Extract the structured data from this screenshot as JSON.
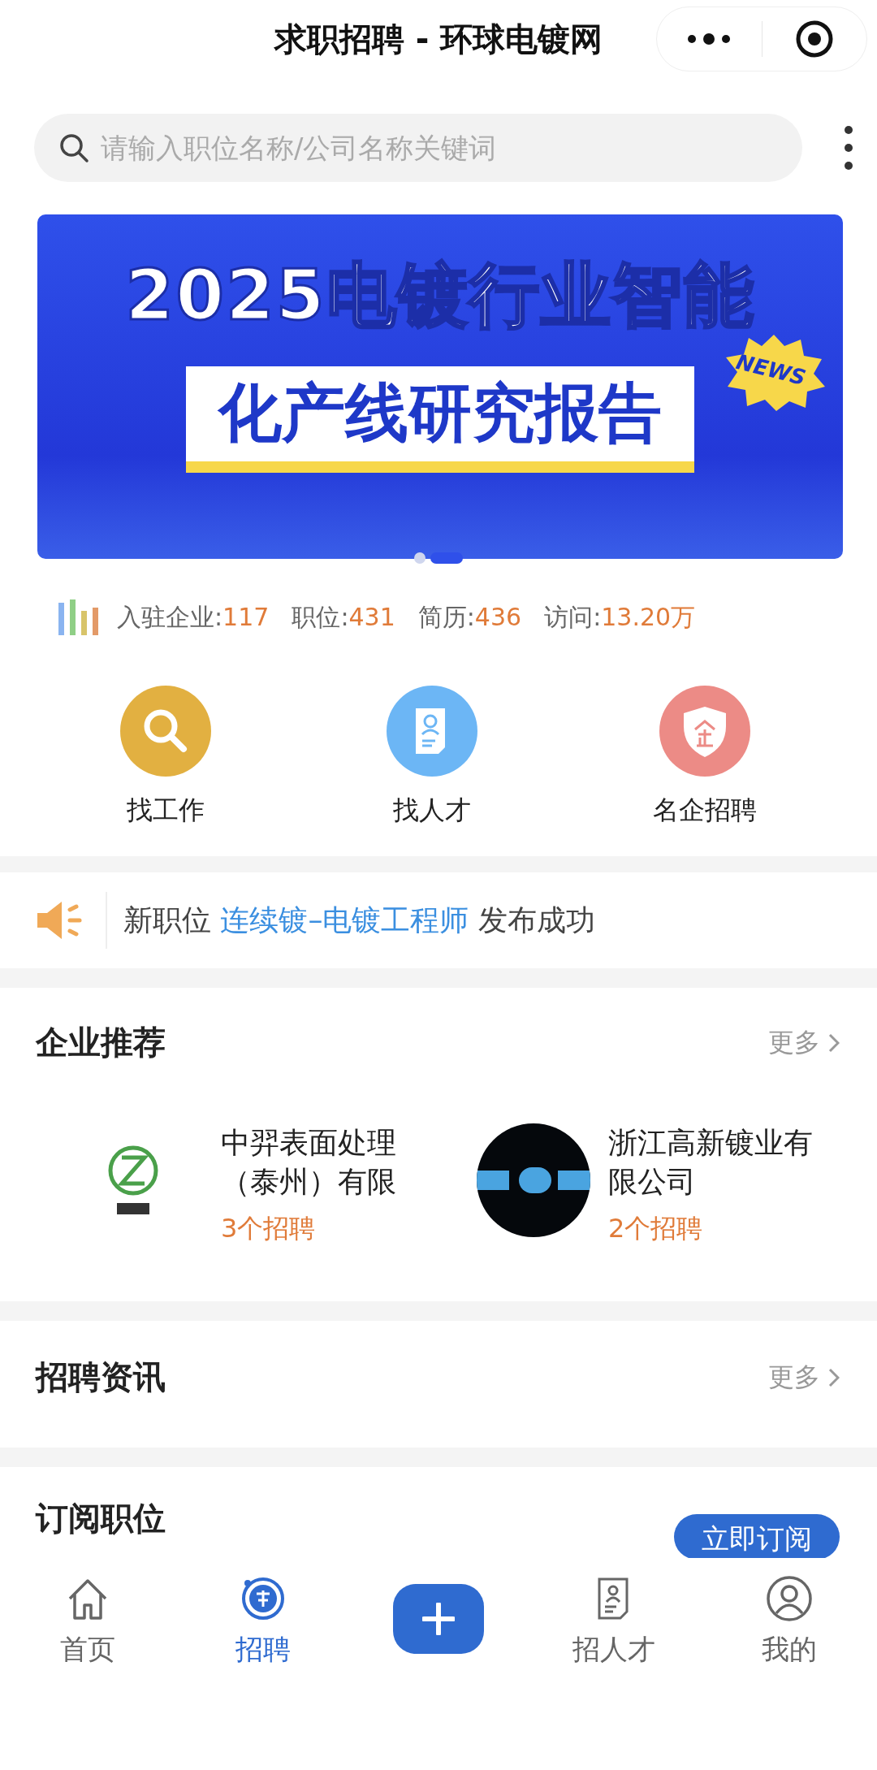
{
  "navbar": {
    "title": "求职招聘 - 环球电镀网"
  },
  "search": {
    "placeholder": "请输入职位名称/公司名称关键词"
  },
  "banner": {
    "line_1": "2025电镀行业智能",
    "line_2": "化产线研究报告",
    "tag": "NEWS"
  },
  "banner_dots": [
    {
      "selected": false
    },
    {
      "selected": true
    }
  ],
  "stats": [
    {
      "label": "入驻企业:",
      "value": "117"
    },
    {
      "label": "职位:",
      "value": "431"
    },
    {
      "label": "简历:",
      "value": "436"
    },
    {
      "label": "访问:",
      "value": "13.20万"
    }
  ],
  "quick_links": [
    {
      "kind": "search",
      "label": "找工作",
      "color": "#e2b041"
    },
    {
      "kind": "resume",
      "label": "找人才",
      "color": "#6cb6f5"
    },
    {
      "kind": "shield",
      "label": "名企招聘",
      "color": "#ec8b86"
    }
  ],
  "notice": {
    "prefix": "新职位",
    "link": "连续镀–电镀工程师",
    "suffix": "发布成功"
  },
  "companies_section": {
    "title": "企业推荐",
    "more": "更多",
    "companies": [
      {
        "name": "中羿表面处理（泰州）有限",
        "jobs": "3个招聘"
      },
      {
        "name": "浙江高新镀业有限公司",
        "jobs": "2个招聘"
      }
    ]
  },
  "news_section": {
    "title": "招聘资讯",
    "more": "更多"
  },
  "subscribe_section": {
    "title": "订阅职位",
    "button": "立即订阅"
  },
  "tabbar": [
    {
      "kind": "home",
      "label": "首页",
      "selected": false
    },
    {
      "kind": "hire",
      "label": "招聘",
      "selected": true
    },
    {
      "kind": "add"
    },
    {
      "kind": "resume",
      "label": "招人才",
      "selected": false
    },
    {
      "kind": "user",
      "label": "我的",
      "selected": false
    }
  ]
}
